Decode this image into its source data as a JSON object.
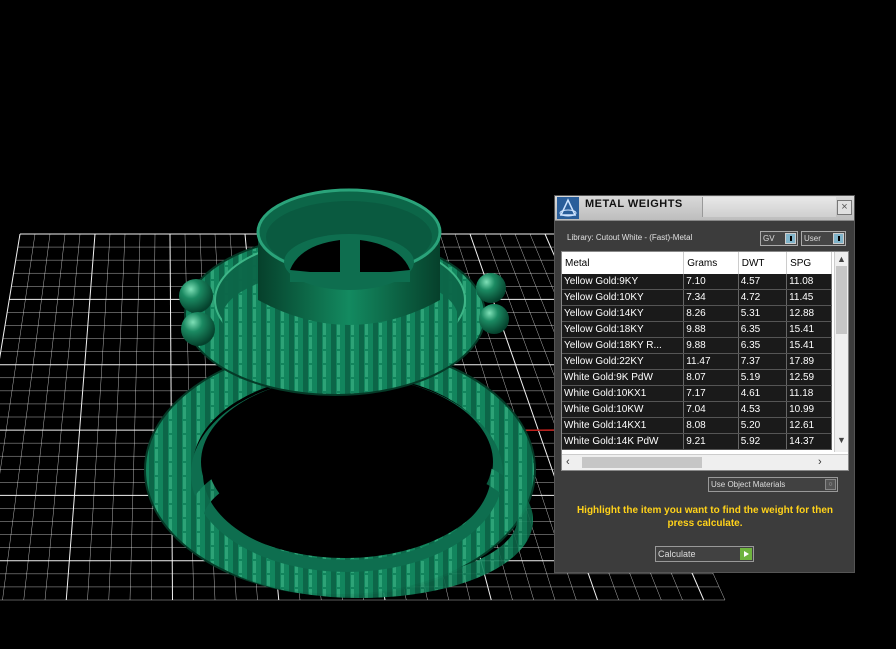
{
  "panel": {
    "title": "METAL WEIGHTS",
    "close_label": "×",
    "library_label": "Library: Cutout White - (Fast)-Metal",
    "toggle_gv": "GV",
    "toggle_user": "User",
    "columns": [
      "Metal",
      "Grams",
      "DWT",
      "SPG"
    ],
    "rows": [
      [
        "Yellow Gold:9KY",
        "7.10",
        "4.57",
        "11.08"
      ],
      [
        "Yellow Gold:10KY",
        "7.34",
        "4.72",
        "11.45"
      ],
      [
        "Yellow Gold:14KY",
        "8.26",
        "5.31",
        "12.88"
      ],
      [
        "Yellow Gold:18KY",
        "9.88",
        "6.35",
        "15.41"
      ],
      [
        "Yellow Gold:18KY R...",
        "9.88",
        "6.35",
        "15.41"
      ],
      [
        "Yellow Gold:22KY",
        "11.47",
        "7.37",
        "17.89"
      ],
      [
        "White Gold:9K PdW",
        "8.07",
        "5.19",
        "12.59"
      ],
      [
        "White Gold:10KX1",
        "7.17",
        "4.61",
        "11.18"
      ],
      [
        "White Gold:10KW",
        "7.04",
        "4.53",
        "10.99"
      ],
      [
        "White Gold:14KX1",
        "8.08",
        "5.20",
        "12.61"
      ],
      [
        "White Gold:14K PdW",
        "9.21",
        "5.92",
        "14.37"
      ]
    ],
    "material_select": "Use Object Materials",
    "hint": "Highlight the item you want to find the weight for then press calculate.",
    "calculate_label": "Calculate"
  },
  "colors": {
    "ring": "#0e6e4f",
    "grid": "#ffffff",
    "axis_x": "#c0201c",
    "axis_y": "#2aa3b8",
    "hint": "#ffd21a",
    "background": "#000000"
  }
}
